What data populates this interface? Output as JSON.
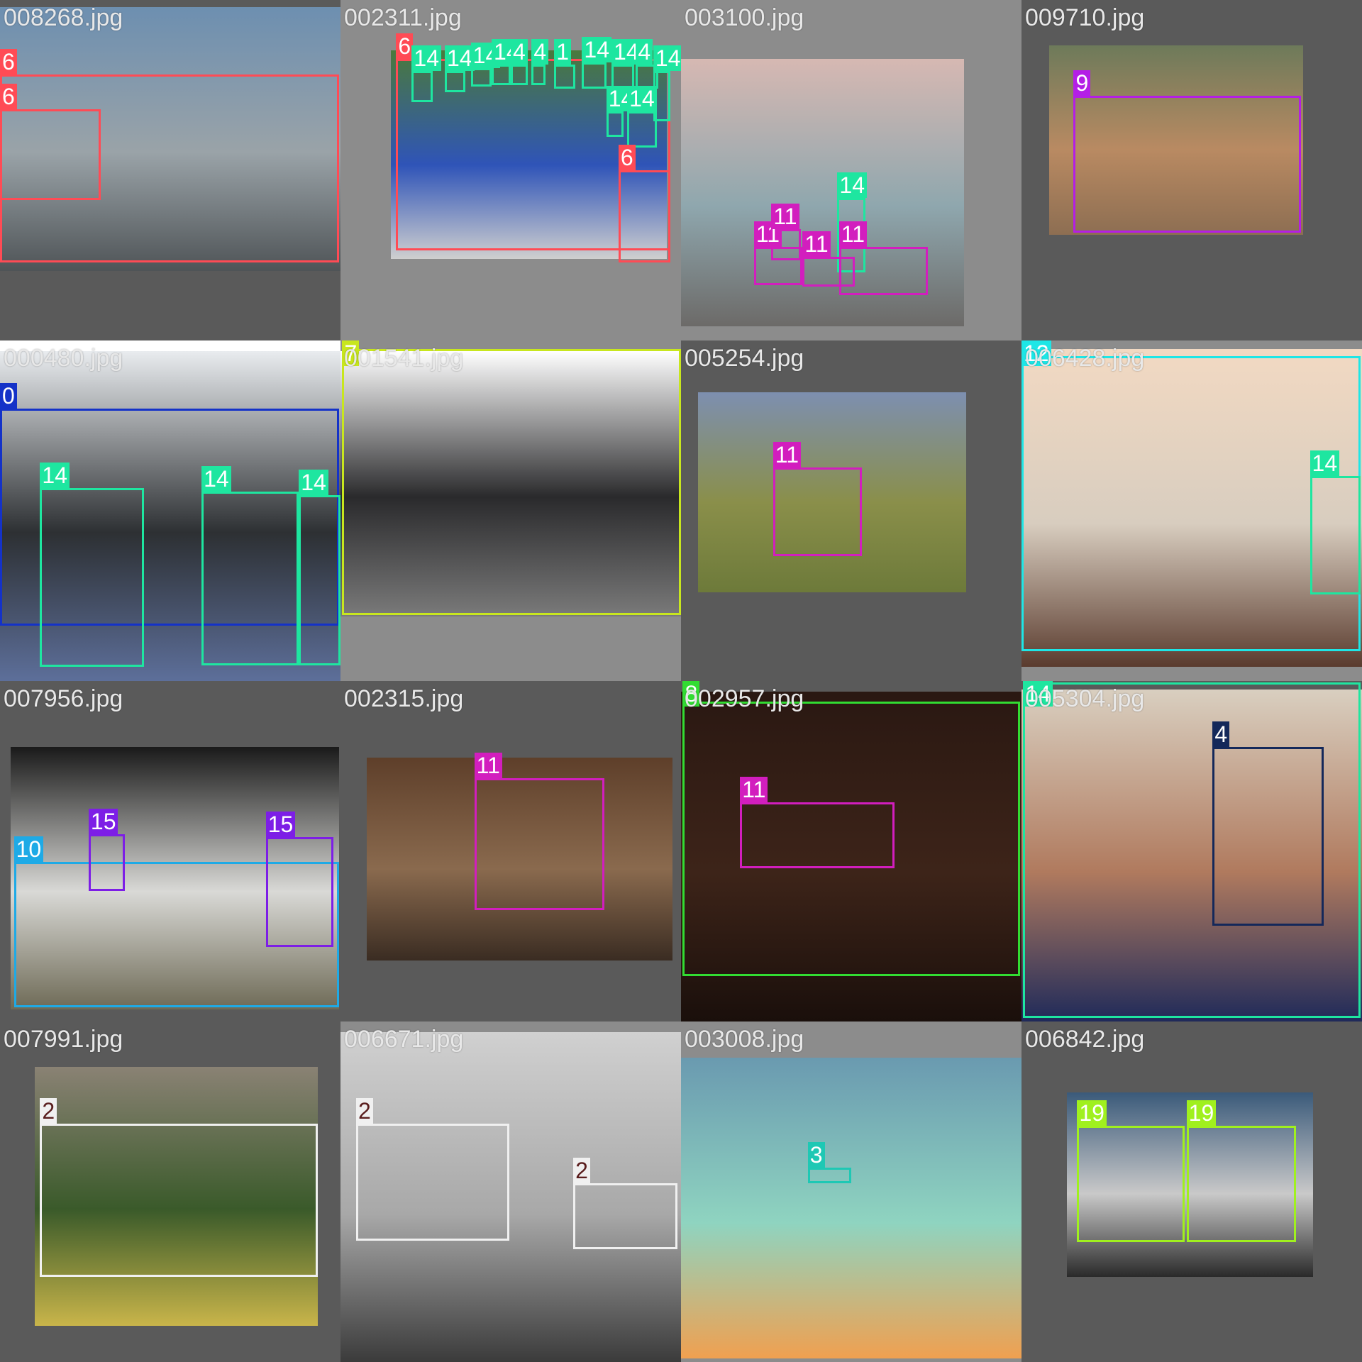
{
  "mosaic": {
    "tiles": [
      {
        "filename": "008268.jpg",
        "bg": "#5a5a5a",
        "photo_colors": [
          "#6d8fb0",
          "#9aa3a8",
          "#4f5457"
        ],
        "detections": [
          {
            "label": "6",
            "color": "#ff4b55"
          },
          {
            "label": "6",
            "color": "#ff4b55"
          }
        ]
      },
      {
        "filename": "002311.jpg",
        "bg": "#8c8c8c",
        "photo_colors": [
          "#4a7a3c",
          "#2f54b8",
          "#cfcfcf"
        ],
        "detections": [
          {
            "label": "6",
            "color": "#ff4b55"
          },
          {
            "label": "6",
            "color": "#ff4b55"
          },
          {
            "label": "14",
            "color": "#1ee6a0"
          },
          {
            "label": "14",
            "color": "#1ee6a0"
          },
          {
            "label": "14",
            "color": "#1ee6a0"
          },
          {
            "label": "14",
            "color": "#1ee6a0"
          },
          {
            "label": "4",
            "color": "#1ee6a0"
          },
          {
            "label": "4",
            "color": "#1ee6a0"
          },
          {
            "label": "1",
            "color": "#1ee6a0"
          },
          {
            "label": "14",
            "color": "#1ee6a0"
          },
          {
            "label": "14",
            "color": "#1ee6a0"
          },
          {
            "label": "4",
            "color": "#1ee6a0"
          },
          {
            "label": "14",
            "color": "#1ee6a0"
          },
          {
            "label": "14",
            "color": "#1ee6a0"
          },
          {
            "label": "14",
            "color": "#1ee6a0"
          }
        ]
      },
      {
        "filename": "003100.jpg",
        "bg": "#8c8c8c",
        "photo_colors": [
          "#d6b8b2",
          "#8fa7ae",
          "#6c6a68"
        ],
        "detections": [
          {
            "label": "14",
            "color": "#1ee6a0"
          },
          {
            "label": "11",
            "color": "#d21ebe"
          },
          {
            "label": "11",
            "color": "#d21ebe"
          },
          {
            "label": "11",
            "color": "#d21ebe"
          },
          {
            "label": "11",
            "color": "#d21ebe"
          }
        ]
      },
      {
        "filename": "009710.jpg",
        "bg": "#5a5a5a",
        "photo_colors": [
          "#6d7a5a",
          "#b98a62",
          "#8d6e52"
        ],
        "detections": [
          {
            "label": "9",
            "color": "#b41ee6"
          }
        ]
      },
      {
        "filename": "000480.jpg",
        "bg": "#ffffff",
        "photo_colors": [
          "#e9ecef",
          "#2d3033",
          "#5d6f9a"
        ],
        "detections": [
          {
            "label": "0",
            "color": "#1432c8"
          },
          {
            "label": "14",
            "color": "#1ee6a0"
          },
          {
            "label": "14",
            "color": "#1ee6a0"
          },
          {
            "label": "14",
            "color": "#1ee6a0"
          }
        ]
      },
      {
        "filename": "001541.jpg",
        "bg": "#8c8c8c",
        "photo_colors": [
          "#ffffff",
          "#2a2a2c",
          "#7a7a7a"
        ],
        "detections": [
          {
            "label": "7",
            "color": "#c8e61e"
          }
        ]
      },
      {
        "filename": "005254.jpg",
        "bg": "#5a5a5a",
        "photo_colors": [
          "#7d8fb0",
          "#8a8f4a",
          "#6d7a3a"
        ],
        "detections": [
          {
            "label": "11",
            "color": "#d21ebe"
          }
        ]
      },
      {
        "filename": "006428.jpg",
        "bg": "#8c8c8c",
        "photo_colors": [
          "#f2d9c2",
          "#d8cdbf",
          "#5a3b2e"
        ],
        "detections": [
          {
            "label": "12",
            "color": "#1ee6e6"
          },
          {
            "label": "14",
            "color": "#1ee6a0"
          }
        ]
      },
      {
        "filename": "007956.jpg",
        "bg": "#5a5a5a",
        "photo_colors": [
          "#1a1a1a",
          "#d9d9d6",
          "#6e6a56"
        ],
        "detections": [
          {
            "label": "10",
            "color": "#1eaae6"
          },
          {
            "label": "15",
            "color": "#7d1ee6"
          },
          {
            "label": "15",
            "color": "#7d1ee6"
          }
        ]
      },
      {
        "filename": "002315.jpg",
        "bg": "#5a5a5a",
        "photo_colors": [
          "#5e3f2a",
          "#8a6a4e",
          "#3a2c22"
        ],
        "detections": [
          {
            "label": "11",
            "color": "#d21ebe"
          }
        ]
      },
      {
        "filename": "002957.jpg",
        "bg": "#5a5a5a",
        "photo_colors": [
          "#2a1812",
          "#3d2419",
          "#1a0f0b"
        ],
        "detections": [
          {
            "label": "8",
            "color": "#32dc32"
          },
          {
            "label": "11",
            "color": "#d21ebe"
          }
        ]
      },
      {
        "filename": "005304.jpg",
        "bg": "#5a5a5a",
        "photo_colors": [
          "#d9cfc0",
          "#b07a5e",
          "#1f2a5a"
        ],
        "detections": [
          {
            "label": "14",
            "color": "#1ee6a0"
          },
          {
            "label": "4",
            "color": "#14285a"
          }
        ]
      },
      {
        "filename": "007991.jpg",
        "bg": "#5a5a5a",
        "photo_colors": [
          "#8a8274",
          "#3a5a2a",
          "#c9b54a"
        ],
        "detections": [
          {
            "label": "2",
            "color": "#f0f0f0"
          }
        ]
      },
      {
        "filename": "006671.jpg",
        "bg": "#8c8c8c",
        "photo_colors": [
          "#d0d0d0",
          "#a8a8a8",
          "#3a3a3a"
        ],
        "detections": [
          {
            "label": "2",
            "color": "#f0f0f0"
          },
          {
            "label": "2",
            "color": "#f0f0f0"
          }
        ]
      },
      {
        "filename": "003008.jpg",
        "bg": "#8c8c8c",
        "photo_colors": [
          "#6a9ab0",
          "#8fd4c0",
          "#f0a050"
        ],
        "detections": [
          {
            "label": "3",
            "color": "#1ec8b4"
          }
        ]
      },
      {
        "filename": "006842.jpg",
        "bg": "#5a5a5a",
        "photo_colors": [
          "#3a5a7a",
          "#c9c9c9",
          "#2a2a2a"
        ],
        "detections": [
          {
            "label": "19",
            "color": "#a0f01e"
          },
          {
            "label": "19",
            "color": "#a0f01e"
          }
        ]
      }
    ]
  }
}
